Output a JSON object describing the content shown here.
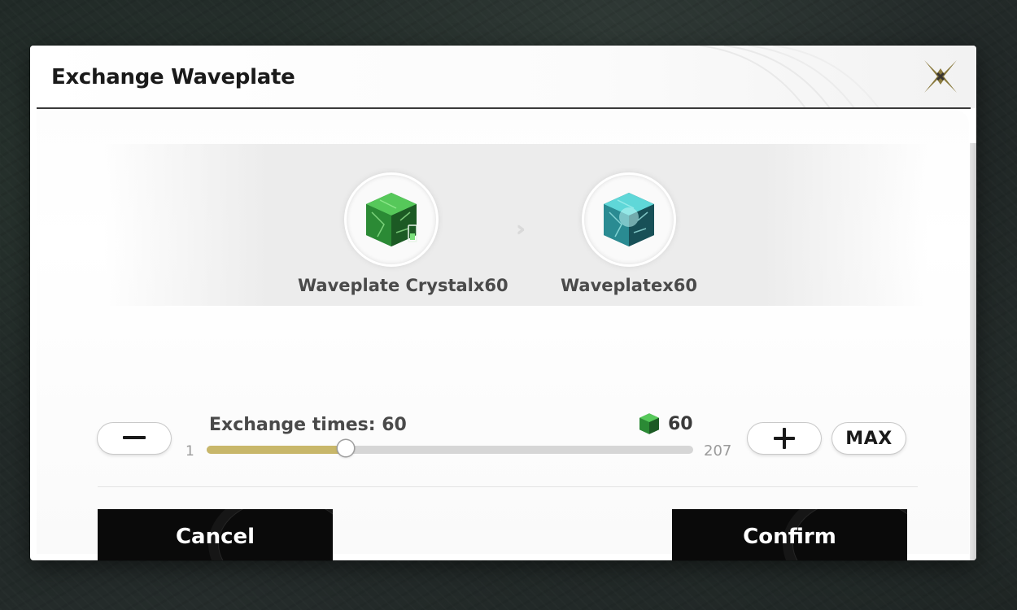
{
  "dialog": {
    "title": "Exchange Waveplate",
    "close_icon": "close-x-icon"
  },
  "exchange": {
    "from_item": {
      "name": "Waveplate Crystalx60",
      "icon": "green-crystal-cube-icon",
      "color": "#3fae3f"
    },
    "to_item": {
      "name": "Waveplatex60",
      "icon": "teal-crystal-cube-icon",
      "color": "#3cc4c4"
    },
    "arrow_icon": "double-chevron-right-icon"
  },
  "stepper": {
    "minus_label": "−",
    "plus_label": "+",
    "max_label": "MAX",
    "exchange_times_label": "Exchange times: 60",
    "cost_value": "60",
    "cost_icon": "green-crystal-cube-icon",
    "range_min": "1",
    "range_max": "207",
    "current_value": 60,
    "min_value": 1,
    "max_value": 207
  },
  "actions": {
    "cancel_label": "Cancel",
    "confirm_label": "Confirm"
  },
  "colors": {
    "slider_fill": "#c8b76a",
    "button_dark": "#0a0a0a",
    "accent_gold": "#8a7a3e"
  }
}
